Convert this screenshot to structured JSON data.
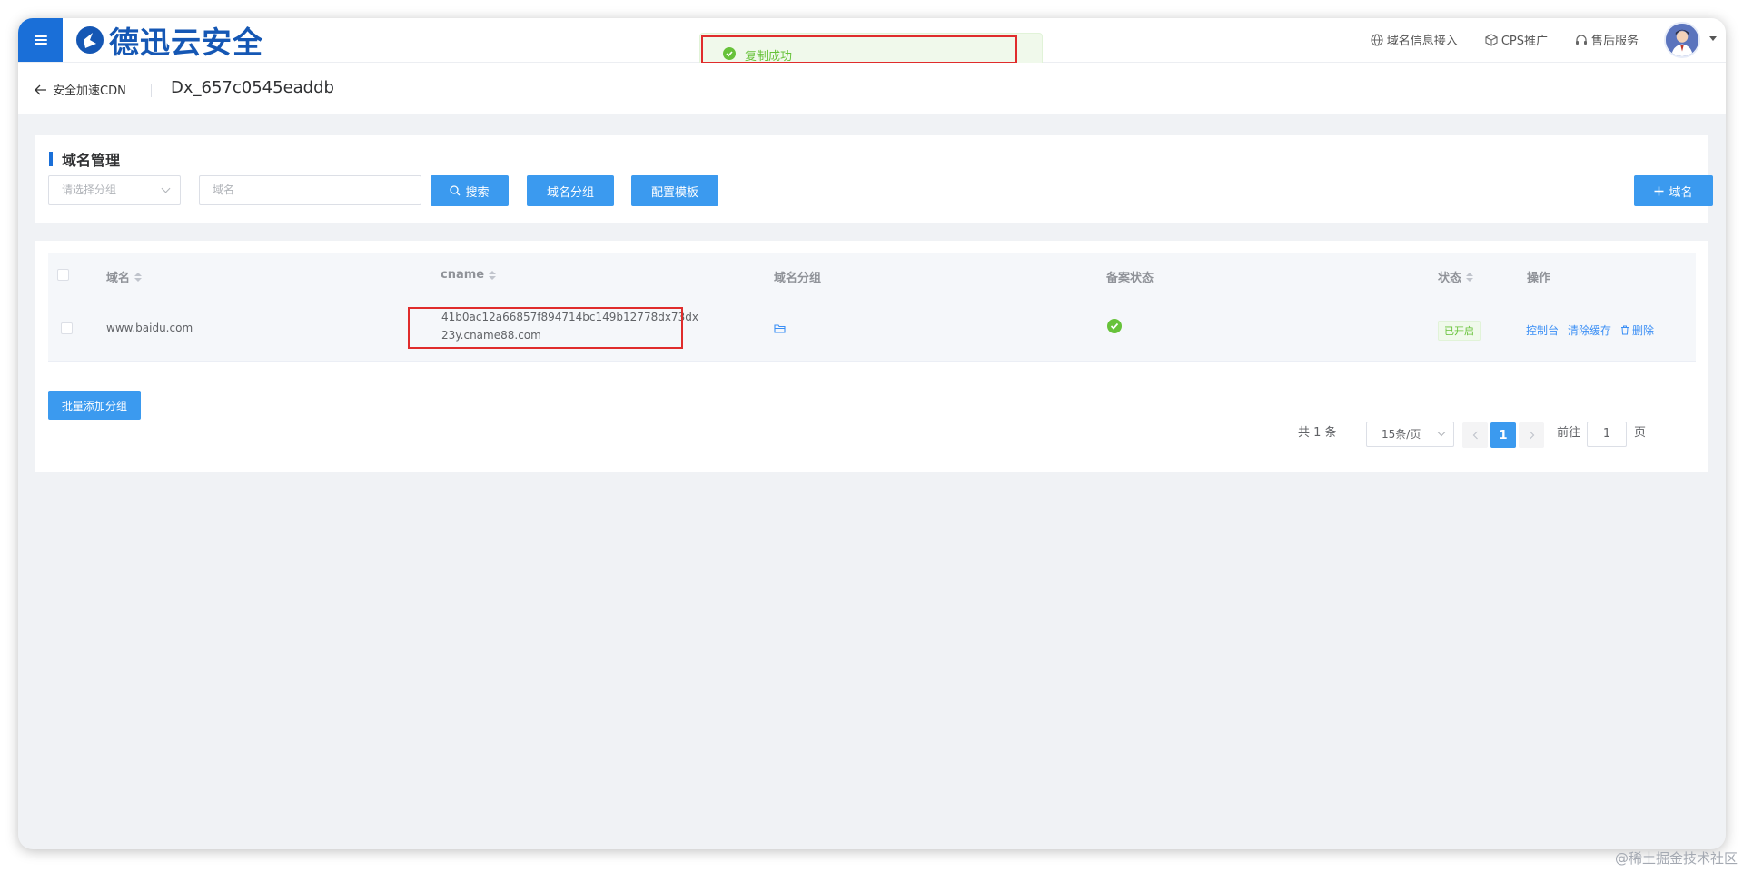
{
  "app": {
    "brand_name": "德迅云安全",
    "top_links": [
      {
        "label": "域名信息接入",
        "icon": "globe-icon"
      },
      {
        "label": "CPS推广",
        "icon": "cube-icon"
      },
      {
        "label": "售后服务",
        "icon": "headset-icon"
      }
    ]
  },
  "toast": {
    "message": "复制成功",
    "icon": "check-circle-icon",
    "color": "#67c23a"
  },
  "breadcrumb": {
    "back_label": "安全加速CDN",
    "title": "Dx_657c0545eaddb"
  },
  "filter_panel": {
    "title": "域名管理",
    "group_select_placeholder": "请选择分组",
    "domain_input_placeholder": "域名",
    "search_label": "搜索",
    "group_button_label": "域名分组",
    "template_button_label": "配置模板",
    "add_domain_label": "域名"
  },
  "table": {
    "columns": [
      "域名",
      "cname",
      "域名分组",
      "备案状态",
      "状态",
      "操作"
    ],
    "rows": [
      {
        "domain": "www.baidu.com",
        "cname": "41b0ac12a66857f894714bc149b12778dx73dx23y.cname88.com",
        "status": "已开启",
        "actions": [
          "控制台",
          "清除缓存",
          "删除"
        ]
      }
    ],
    "batch_button_label": "批量添加分组"
  },
  "pagination": {
    "total_label": "共 1 条",
    "page_size_label": "15条/页",
    "current_page": "1",
    "goto_prefix": "前往",
    "goto_value": "1",
    "goto_suffix": "页"
  },
  "watermark": "@稀土掘金技术社区",
  "colors": {
    "primary": "#3b9aef",
    "brand": "#1a6fd8",
    "success": "#67c23a",
    "highlight": "#e02c2c"
  }
}
